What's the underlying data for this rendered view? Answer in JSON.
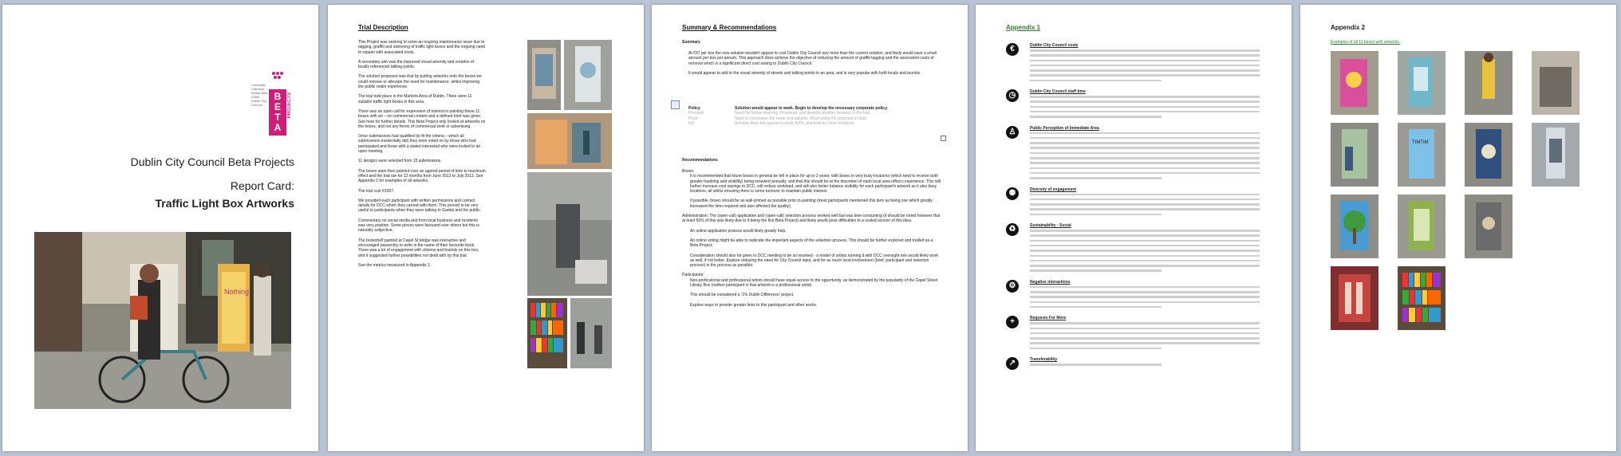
{
  "cover": {
    "org_small": "Comhairle Cathrach Bhaile Átha Cliath Dublin City Council",
    "logo_text": "BETA",
    "logo_side": "PROJECTS",
    "line1": "Dublin City Council Beta Projects",
    "line2": "Report Card:",
    "line3": "Traffic Light Box Artworks"
  },
  "page2": {
    "title": "Trial Description",
    "paragraphs": [
      "This Project was seeking to solve an ongoing maintenance issue due to tagging, graffiti and stickering of traffic light boxes and the ongoing need to repaint with associated costs.",
      "A secondary aim was the improved visual amenity and creation of locally referenced talking points.",
      "The solution proposed was that by putting artworks onto the boxes we could remove or alleviate the need for maintenance, whilst improving the public realm experience.",
      "The trial took place in the Markets Area of Dublin. There were 11 suitable traffic light boxes in this area.",
      "There was an open call for expression of interest in painting these 11 boxes with art – no commercial content and a defined brief was given. See here for further details. This Beta Project only looked at artworks on the boxes, and not any forms of commercial work or advertising.",
      "Once submissions had qualified (to fit the criteria – which all submissions incidentally did) they were voted on by those who had participated and those with a stated interested who were invited to an open meeting.",
      "11 designs were selected from 15 submissions.",
      "The boxes were then painted over an agreed period of time to maximum effect and the trial ran for 12 months from June 2013 to July 2013. See Appendix 2 for examples of all artworks.",
      "The trial cost €1067.",
      "We provided each participant with written permissions and contact details for DCC which they carried with them. This proved to be very useful to participants when they were talking to Gardai and the public.",
      "Commentary on social media and from local business and residents was very positive. Some pieces were favoured over others but this is naturally subjective.",
      "The bookshelf painted at Capel St bridge was interactive and encouraged passersby to write in the name of their favourite book. There was a lot of engagement with citizens and tourists on this box, and it suggested further possibilities not dealt with by this trial.",
      "See the metrics measured in Appendix 1."
    ]
  },
  "page3": {
    "title": "Summary & Recommendations",
    "summary_head": "Summary",
    "summary": [
      "At €97 per box the new solution wouldn't appear to cost Dublin City Council any more than the current solution, and likely would save a small amount per box per annum. This approach does achieve the objective of reducing the amount of graffiti tagging and the associated costs of removal which is a significant direct cost saving to Dublin City Council.",
      "It would appear to add to the visual amenity of streets and talking points in an area, and is very popular with both locals and tourists."
    ],
    "policy_label": "Policy",
    "policy_text": "Solution would appear to work. Begin to develop the necessary corporate policy.",
    "options": [
      {
        "k": "Proceed",
        "v": "Need for further learning. Proceeds, and develop another iteration of the trial."
      },
      {
        "k": "Pivot",
        "v": "Need to reconsider the issue and solution. Pivot using the proposal to date."
      },
      {
        "k": "Kill",
        "v": "Solution does not appear to work. Kill it, and look for other solutions."
      }
    ],
    "rec_head": "Recommendations",
    "boxes_label": "Boxes:",
    "boxes": [
      "It is recommended that future boxes in general be left in place for up to 2 years, with boxes in very busy locations (which tend to receive both greater hardship and visibility) being renewed annually, and that this should be at the discretion of each local area office's experience. This will further increase cost savings to DCC, will reduce workload, and will also better balance visibility for each participant's artwork as it also busy locations, all whilst ensuring there is some turnover to maintain public interest.",
      "If possible, boxes should be as wall-primed as possible prior to painting (most participants mentioned this item as being one which greatly increased the time required and also affected the quality)."
    ],
    "admin": "Administration: The (open-call) application and (open-call) selection process worked well but was time-consuming (it should be noted however that at least 50% of this was likely due to it being the first Beta Project) and likely would pose difficulties to a scaled version of this idea.",
    "admin_bullets": [
      "An online application process would likely greatly help.",
      "An online voting might be able to replicate the important aspects of the selection process. This should be further explored and trialled as a Beta Project.",
      "Consideration should also be given to DCC needing to be so involved - a model of artists running it with DCC oversight role would likely work as well, if not better. Explore reducing the need for City Council input, and for as much local involvement (brief, participant and selection process) in the process as possible."
    ],
    "participants_label": "Participants:",
    "participants": [
      "Non-professional and professional artists should have equal access to the opportunity, as demonstrated by the popularity of the Capel Street Library Box (neither participant in that artwork is a professional artist).",
      "This should be considered a '1% Dublin Difference' project.",
      "Explore ways to provide greater links to this participant and other works."
    ]
  },
  "page4": {
    "title": "Appendix 1",
    "sections": [
      {
        "icon": "€",
        "name": "euro-icon",
        "head": "Dublin City Council costs",
        "lines": 7
      },
      {
        "icon": "◷",
        "name": "clock-icon",
        "head": "Dublin City Council staff time",
        "lines": 5
      },
      {
        "icon": "♙",
        "name": "person-icon",
        "head": "Public Perception of Immediate Area",
        "lines": 10
      },
      {
        "icon": "⚉",
        "name": "people-icon",
        "head": "Diversity of engagement",
        "lines": 5
      },
      {
        "icon": "♻",
        "name": "recycle-icon",
        "head": "Sustainability - Social",
        "lines": 9
      },
      {
        "icon": "⚙",
        "name": "gear-icon",
        "head": "Negative interactions",
        "lines": 5
      },
      {
        "icon": "+",
        "name": "plus-icon",
        "head": "Requests For More",
        "lines": 6
      },
      {
        "icon": "↗",
        "name": "arrow-icon",
        "head": "Transferability",
        "lines": 1
      }
    ]
  },
  "page5": {
    "title": "Appendix 2",
    "subtitle": "Examples of all 11 boxes with artworks."
  }
}
